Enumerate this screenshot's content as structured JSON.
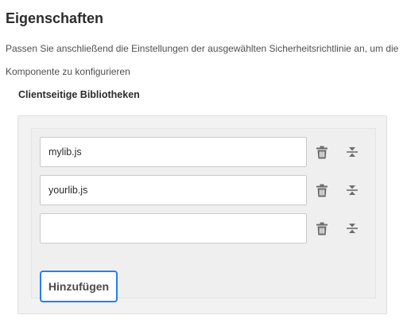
{
  "header": {
    "title": "Eigenschaften",
    "description": "Passen Sie anschließend die Einstellungen der ausgewählten Sicherheitsrichtlinie an, um die Komponente zu konfigurieren"
  },
  "field": {
    "label": "Clientseitige Bibliotheken",
    "rows": [
      {
        "value": "mylib.js",
        "delete_icon": "trash-icon",
        "move_icon": "reorder-icon"
      },
      {
        "value": "yourlib.js",
        "delete_icon": "trash-icon",
        "move_icon": "reorder-icon"
      },
      {
        "value": "",
        "delete_icon": "trash-icon",
        "move_icon": "reorder-icon"
      }
    ],
    "add_label": "Hinzufügen"
  },
  "colors": {
    "accent": "#2680eb",
    "panel_background": "#f2f2f2",
    "icon": "#6e6e6e"
  }
}
